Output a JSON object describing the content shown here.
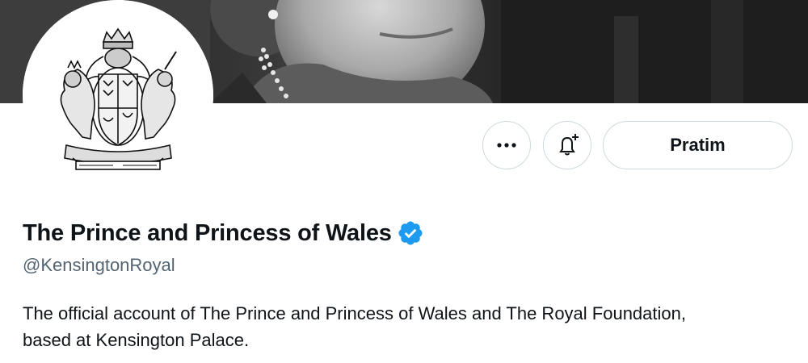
{
  "profile": {
    "display_name": "The Prince and Princess of Wales",
    "handle": "@KensingtonRoyal",
    "verified": true,
    "bio_line1": "The official account of The Prince and Princess of Wales and The Royal Foundation,",
    "bio_line2": "based at Kensington Palace."
  },
  "actions": {
    "more_icon": "more-horizontal-icon",
    "notify_icon": "bell-plus-icon",
    "follow_label": "Pratim"
  },
  "colors": {
    "verified_blue": "#1d9bf0",
    "text_primary": "#0f1419",
    "text_secondary": "#536471",
    "button_border": "#cfd9de"
  }
}
